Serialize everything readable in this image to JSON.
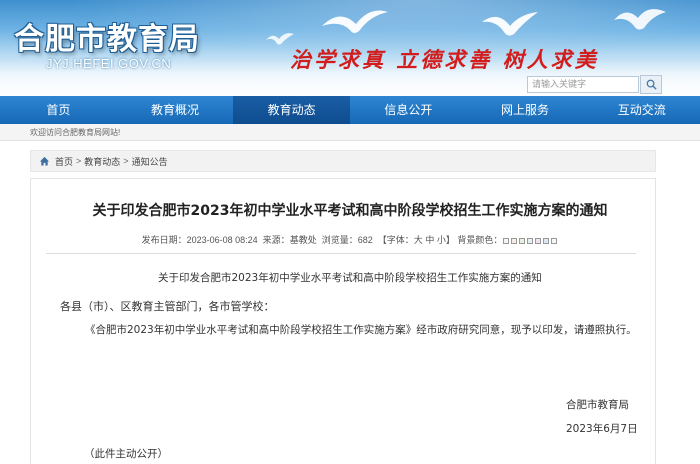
{
  "header": {
    "site_title": "合肥市教育局",
    "site_url": "JYJ.HEFEI.GOV.CN",
    "slogan": "治学求真  立德求善  树人求美",
    "search_placeholder": "请输入关键字"
  },
  "nav": {
    "items": [
      {
        "label": "首页"
      },
      {
        "label": "教育概况"
      },
      {
        "label": "教育动态"
      },
      {
        "label": "信息公开"
      },
      {
        "label": "网上服务"
      },
      {
        "label": "互动交流"
      }
    ],
    "active_index": 2
  },
  "welcome_text": "欢迎访问合肥教育局网站!",
  "breadcrumb": {
    "items": [
      "首页",
      "教育动态",
      "通知公告"
    ],
    "separator": ">"
  },
  "article": {
    "title": "关于印发合肥市2023年初中学业水平考试和高中阶段学校招生工作实施方案的通知",
    "meta": {
      "date_label": "发布日期：",
      "date_value": "2023-06-08 08:24",
      "source_label": "来源：",
      "source_value": "基教处",
      "views_label": "浏览量：",
      "views_value": "682",
      "font_label": "【字体：",
      "font_sizes": [
        "大",
        "中",
        "小"
      ],
      "font_close": "】",
      "bg_label": "背景颜色：",
      "bg_colors": [
        "#f5f5f5",
        "#f3eee1",
        "#e8f0e0",
        "#e6eef8",
        "#ece4f3",
        "#dfe7f3",
        "#f7f7f7"
      ]
    },
    "intro_line": "关于印发合肥市2023年初中学业水平考试和高中阶段学校招生工作实施方案的通知",
    "salutation": "各县（市）、区教育主管部门，各市管学校：",
    "paragraph": "《合肥市2023年初中学业水平考试和高中阶段学校招生工作实施方案》经市政府研究同意，现予以印发，请遵照执行。",
    "signature": "合肥市教育局",
    "date_sign": "2023年6月7日",
    "disclosure": "（此件主动公开）"
  },
  "colors": {
    "nav_bg": "#1a73c4",
    "nav_active": "#0e4c8e",
    "slogan": "#d21d1d"
  }
}
